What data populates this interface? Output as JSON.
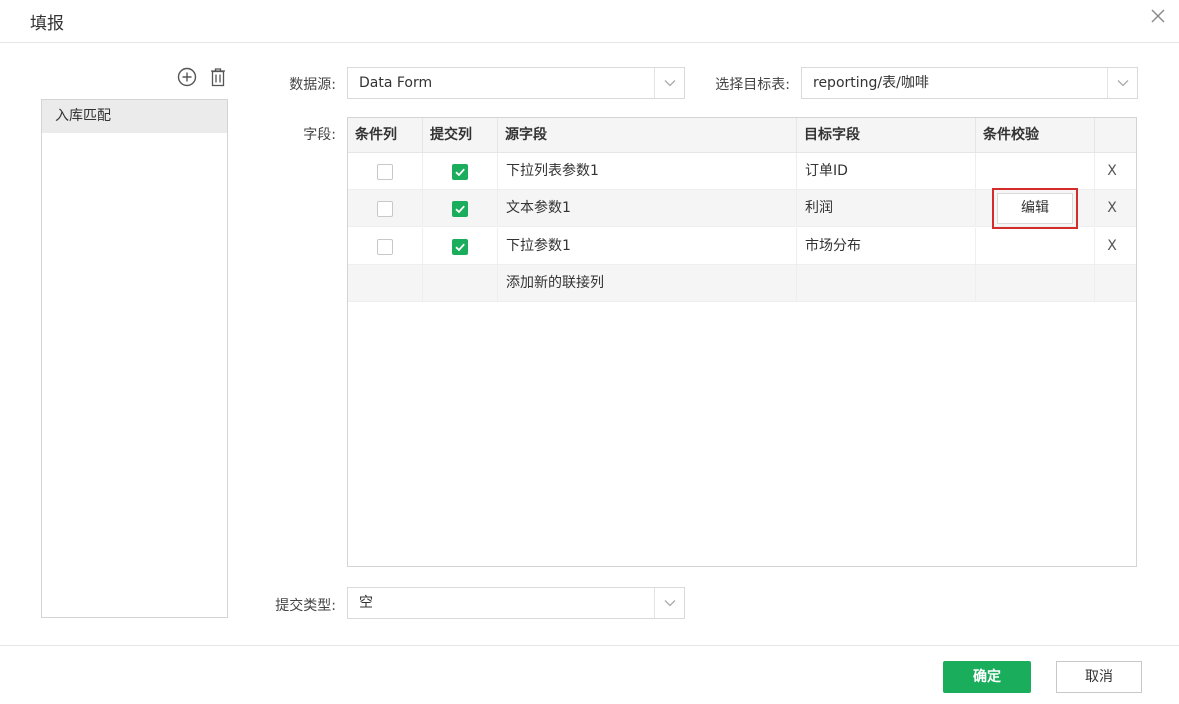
{
  "dialog": {
    "title": "填报",
    "close_icon": "close-icon"
  },
  "left_panel": {
    "add_icon": "add-circle-icon",
    "delete_icon": "trash-icon",
    "items": [
      {
        "label": "入库匹配",
        "selected": true
      }
    ]
  },
  "form": {
    "datasource_label": "数据源:",
    "datasource_value": "Data Form",
    "target_label": "选择目标表:",
    "target_value": "reporting/表/咖啡",
    "fields_label": "字段:",
    "submit_type_label": "提交类型:",
    "submit_type_value": "空"
  },
  "table": {
    "columns": [
      "条件列",
      "提交列",
      "源字段",
      "目标字段",
      "条件校验"
    ],
    "rows": [
      {
        "condition": false,
        "submit": true,
        "source": "下拉列表参数1",
        "target": "订单ID",
        "check": "",
        "delete": "X"
      },
      {
        "condition": false,
        "submit": true,
        "source": "文本参数1",
        "target": "利润",
        "check": "编辑",
        "delete": "X",
        "highlighted": true
      },
      {
        "condition": false,
        "submit": true,
        "source": "下拉参数1",
        "target": "市场分布",
        "check": "",
        "delete": "X"
      }
    ],
    "add_row_label": "添加新的联接列"
  },
  "footer": {
    "ok_label": "确定",
    "cancel_label": "取消"
  },
  "colors": {
    "accent_green": "#1aad5c",
    "highlight_red": "#d42b2b"
  }
}
